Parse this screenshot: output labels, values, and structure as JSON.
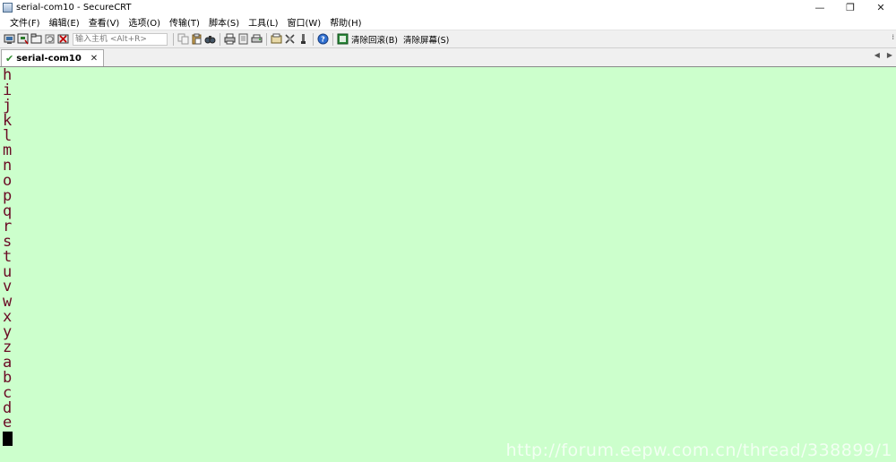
{
  "window": {
    "title": "serial-com10 - SecureCRT",
    "controls": {
      "minimize": "—",
      "restore": "❐",
      "close": "✕"
    }
  },
  "menu": [
    "文件(F)",
    "编辑(E)",
    "查看(V)",
    "选项(O)",
    "传输(T)",
    "脚本(S)",
    "工具(L)",
    "窗口(W)",
    "帮助(H)"
  ],
  "toolbar": {
    "host_placeholder": "输入主机 <Alt+R>",
    "clear_scrollback": "清除回滚(B)",
    "clear_screen": "清除屏幕(S)",
    "overflow": "⁞"
  },
  "tab": {
    "label": "serial-com10",
    "close": "✕",
    "scroll_left": "◀",
    "scroll_right": "▶"
  },
  "terminal": {
    "lines": [
      "h",
      "i",
      "j",
      "k",
      "l",
      "m",
      "n",
      "o",
      "p",
      "q",
      "r",
      "s",
      "t",
      "u",
      "v",
      "w",
      "x",
      "y",
      "z",
      "a",
      "b",
      "c",
      "d",
      "e"
    ],
    "background": "#ccffcc",
    "text_color": "#6a0a24"
  },
  "watermark": "http://forum.eepw.com.cn/thread/338899/1"
}
